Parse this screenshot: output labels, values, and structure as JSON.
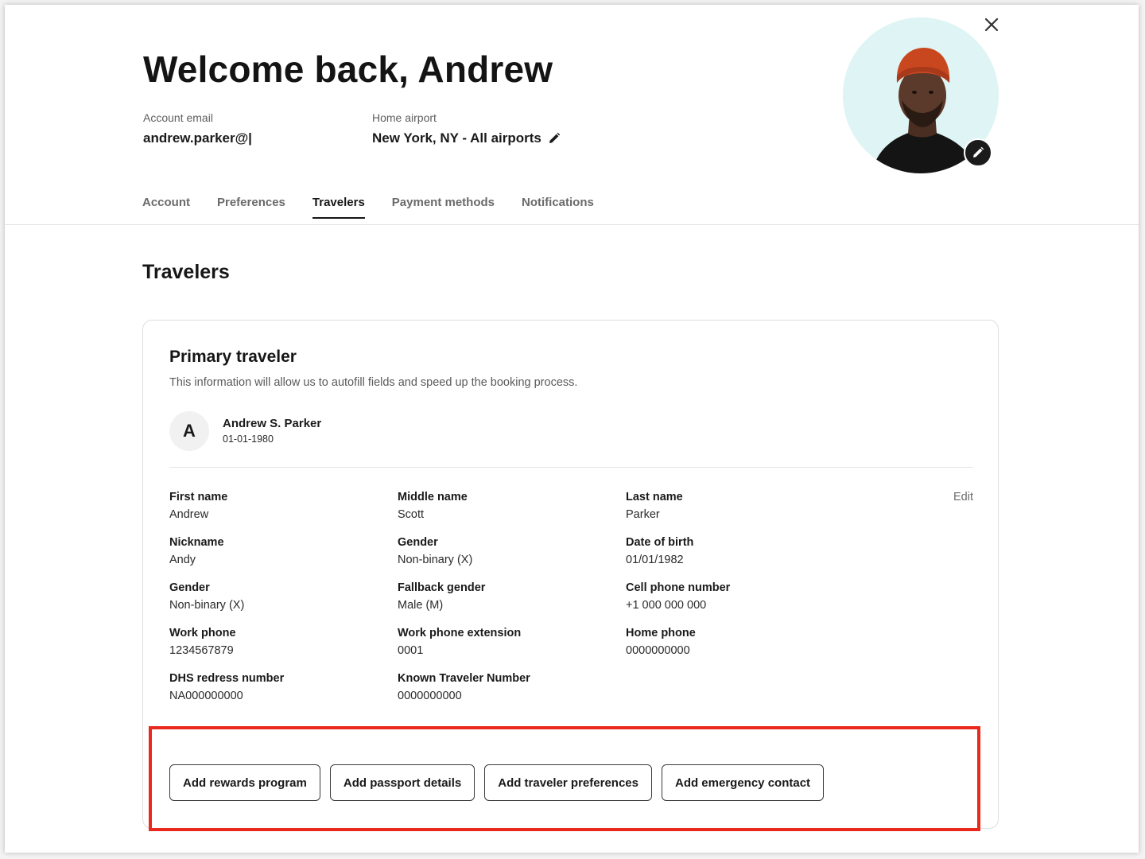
{
  "header": {
    "title": "Welcome back, Andrew",
    "account_email_label": "Account email",
    "account_email_value": "andrew.parker@|",
    "home_airport_label": "Home airport",
    "home_airport_value": "New York, NY - All airports"
  },
  "tabs": [
    {
      "label": "Account",
      "active": false
    },
    {
      "label": "Preferences",
      "active": false
    },
    {
      "label": "Travelers",
      "active": true
    },
    {
      "label": "Payment methods",
      "active": false
    },
    {
      "label": "Notifications",
      "active": false
    }
  ],
  "section_title": "Travelers",
  "card": {
    "title": "Primary traveler",
    "subtitle": "This information will allow us to autofill fields and speed up the booking process.",
    "avatar_initial": "A",
    "traveler_name": "Andrew S. Parker",
    "traveler_dob": "01-01-1980",
    "edit_label": "Edit",
    "fields": [
      {
        "label": "First name",
        "value": "Andrew"
      },
      {
        "label": "Middle name",
        "value": "Scott"
      },
      {
        "label": "Last name",
        "value": "Parker"
      },
      {
        "label": "Nickname",
        "value": "Andy"
      },
      {
        "label": "Gender",
        "value": "Non-binary (X)"
      },
      {
        "label": "Date of birth",
        "value": "01/01/1982"
      },
      {
        "label": "Gender",
        "value": "Non-binary (X)"
      },
      {
        "label": "Fallback gender",
        "value": "Male (M)"
      },
      {
        "label": "Cell phone number",
        "value": "+1 000 000 000"
      },
      {
        "label": "Work phone",
        "value": "1234567879"
      },
      {
        "label": "Work phone extension",
        "value": "0001"
      },
      {
        "label": "Home phone",
        "value": "0000000000"
      },
      {
        "label": "DHS redress number",
        "value": "NA000000000"
      },
      {
        "label": "Known Traveler Number",
        "value": "0000000000"
      }
    ],
    "actions": [
      {
        "label": "Add rewards program"
      },
      {
        "label": "Add passport details"
      },
      {
        "label": "Add traveler preferences"
      },
      {
        "label": "Add emergency contact"
      }
    ]
  },
  "icons": {
    "close": "close-icon",
    "edit_airport": "pencil-icon",
    "edit_avatar": "pencil-icon"
  },
  "colors": {
    "highlight": "#e8291c",
    "avatar_bg": "#dff4f4",
    "beanie": "#c9471f"
  }
}
